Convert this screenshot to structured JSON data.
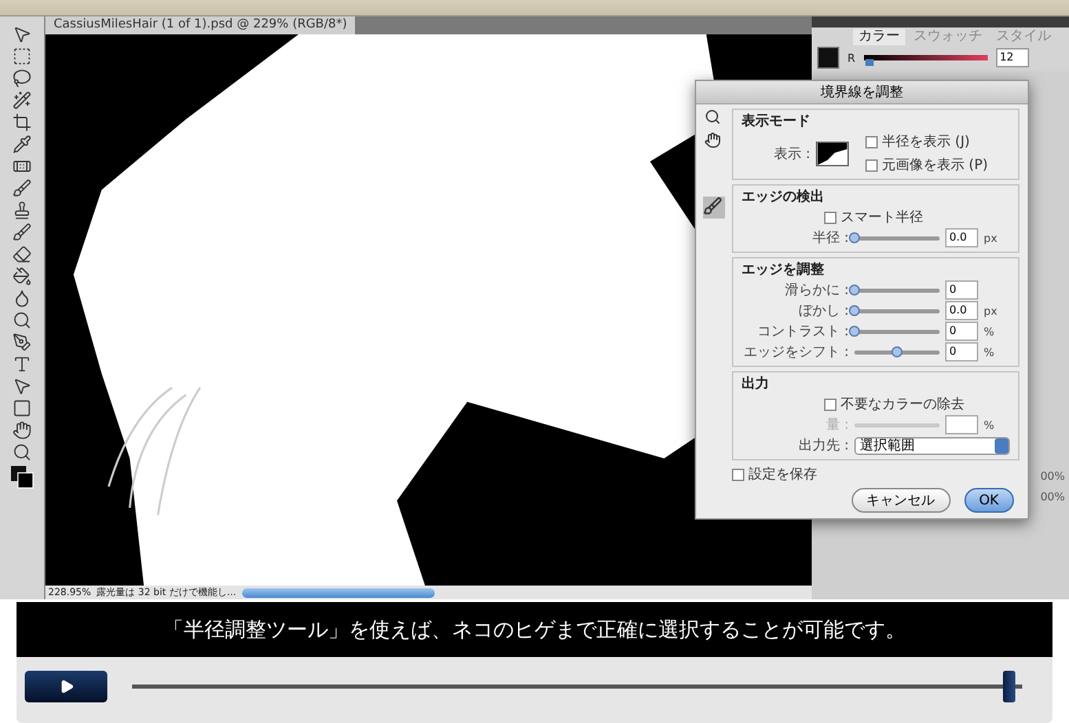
{
  "document": {
    "title": "CassiusMilesHair (1 of 1).psd @ 229% (RGB/8*)",
    "zoom": "228.95%",
    "status": "露光量は 32 bit だけで機能し..."
  },
  "color_panel": {
    "tabs": [
      {
        "label": "カラー",
        "selected": true
      },
      {
        "label": "スウォッチ",
        "selected": false
      },
      {
        "label": "スタイル",
        "selected": false
      }
    ],
    "channel": "R",
    "value": "12",
    "level": 0.05
  },
  "layers_panel": {
    "opacity": [
      "00%",
      "00%"
    ]
  },
  "dialog": {
    "title": "境界線を調整",
    "view_mode": {
      "heading": "表示モード",
      "view_label": "表示 :",
      "checkboxes": [
        {
          "label": "半径を表示 (J)",
          "checked": false
        },
        {
          "label": "元画像を表示 (P)",
          "checked": false
        }
      ]
    },
    "edge_detection": {
      "heading": "エッジの検出",
      "smart_radius": {
        "label": "スマート半径",
        "checked": false
      },
      "sliders": [
        {
          "label": "半径 :",
          "value": "0.0",
          "unit": "px",
          "level": 0,
          "disabled": false
        }
      ]
    },
    "adjust_edge": {
      "heading": "エッジを調整",
      "sliders": [
        {
          "label": "滑らかに :",
          "value": "0",
          "level": 0,
          "disabled": false
        },
        {
          "label": "ぼかし :",
          "value": "0.0",
          "unit": "px",
          "level": 0,
          "disabled": false
        },
        {
          "label": "コントラスト :",
          "value": "0",
          "unit": "%",
          "level": 0,
          "disabled": false
        },
        {
          "label": "エッジをシフト :",
          "value": "0",
          "unit": "%",
          "level": 0.5,
          "disabled": false
        }
      ]
    },
    "output": {
      "heading": "出力",
      "decontaminate": {
        "label": "不要なカラーの除去",
        "checked": false
      },
      "sliders": [
        {
          "label": "量 :",
          "unit": "%",
          "disabled": true
        }
      ],
      "output_to_label": "出力先 :",
      "output_to": "選択範囲"
    },
    "remember": {
      "label": "設定を保存",
      "checked": false
    },
    "buttons": [
      {
        "label": "キャンセル",
        "default": false
      },
      {
        "label": "OK",
        "default": true
      }
    ]
  },
  "caption": "「半径調整ツール」を使えば、ネコのヒゲまで正確に選択することが可能です。",
  "player": {
    "level": 0.985
  }
}
